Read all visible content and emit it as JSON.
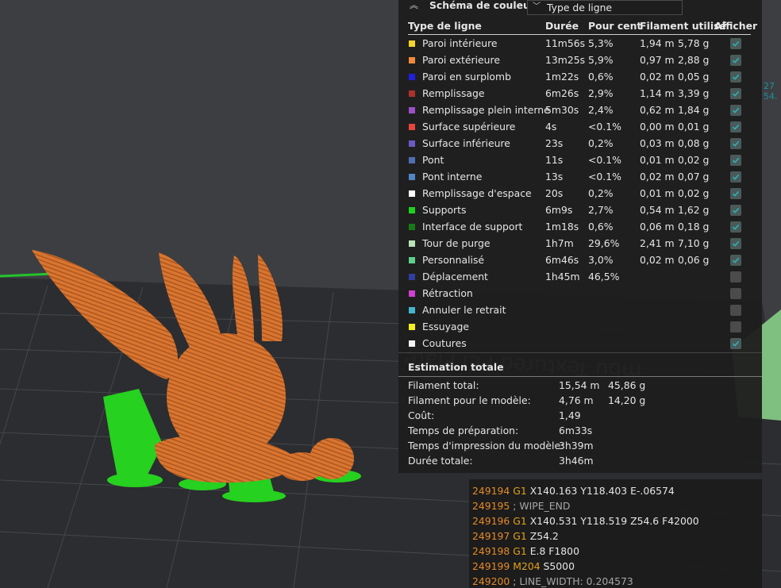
{
  "legend": {
    "title": "Schéma de couleur",
    "view_type": "Type de ligne",
    "columns": [
      "Type de ligne",
      "Durée",
      "Pour cent",
      "Filament utilisé",
      "Afficher"
    ],
    "rows": [
      {
        "name": "Paroi intérieure",
        "color": "#f5d52a",
        "duration": "11m56s",
        "percent": "5,3%",
        "length": "1,94 m",
        "weight": "5,78 g",
        "visible": true
      },
      {
        "name": "Paroi extérieure",
        "color": "#f08a3c",
        "duration": "13m25s",
        "percent": "5,9%",
        "length": "0,97 m",
        "weight": "2,88 g",
        "visible": true
      },
      {
        "name": "Paroi en surplomb",
        "color": "#1f1fe0",
        "duration": "1m22s",
        "percent": "0,6%",
        "length": "0,02 m",
        "weight": "0,05 g",
        "visible": true
      },
      {
        "name": "Remplissage",
        "color": "#b0302c",
        "duration": "6m26s",
        "percent": "2,9%",
        "length": "1,14 m",
        "weight": "3,39 g",
        "visible": true
      },
      {
        "name": "Remplissage plein interne",
        "color": "#9b4fc4",
        "duration": "5m30s",
        "percent": "2,4%",
        "length": "0,62 m",
        "weight": "1,84 g",
        "visible": true
      },
      {
        "name": "Surface supérieure",
        "color": "#e8453c",
        "duration": "4s",
        "percent": "<0.1%",
        "length": "0,00 m",
        "weight": "0,01 g",
        "visible": true
      },
      {
        "name": "Surface inférieure",
        "color": "#6a5bc4",
        "duration": "23s",
        "percent": "0,2%",
        "length": "0,03 m",
        "weight": "0,08 g",
        "visible": true
      },
      {
        "name": "Pont",
        "color": "#4f6fb3",
        "duration": "11s",
        "percent": "<0.1%",
        "length": "0,01 m",
        "weight": "0,02 g",
        "visible": true
      },
      {
        "name": "Pont interne",
        "color": "#4f86c6",
        "duration": "13s",
        "percent": "<0.1%",
        "length": "0,02 m",
        "weight": "0,07 g",
        "visible": true
      },
      {
        "name": "Remplissage d'espace",
        "color": "#ffffff",
        "duration": "20s",
        "percent": "0,2%",
        "length": "0,01 m",
        "weight": "0,02 g",
        "visible": true
      },
      {
        "name": "Supports",
        "color": "#1fd11f",
        "duration": "6m9s",
        "percent": "2,7%",
        "length": "0,54 m",
        "weight": "1,62 g",
        "visible": true
      },
      {
        "name": "Interface de support",
        "color": "#157a15",
        "duration": "1m18s",
        "percent": "0,6%",
        "length": "0,06 m",
        "weight": "0,18 g",
        "visible": true
      },
      {
        "name": "Tour de purge",
        "color": "#b7e3b7",
        "duration": "1h7m",
        "percent": "29,6%",
        "length": "2,41 m",
        "weight": "7,10 g",
        "visible": true
      },
      {
        "name": "Personnalisé",
        "color": "#5ecf8a",
        "duration": "6m46s",
        "percent": "3,0%",
        "length": "0,02 m",
        "weight": "0,06 g",
        "visible": true
      },
      {
        "name": "Déplacement",
        "color": "#2f3fa0",
        "duration": "1h45m",
        "percent": "46,5%",
        "length": "",
        "weight": "",
        "visible": false
      },
      {
        "name": "Rétraction",
        "color": "#d23fd2",
        "duration": "",
        "percent": "",
        "length": "",
        "weight": "",
        "visible": false
      },
      {
        "name": "Annuler le retrait",
        "color": "#45b5cf",
        "duration": "",
        "percent": "",
        "length": "",
        "weight": "",
        "visible": false
      },
      {
        "name": "Essuyage",
        "color": "#f5f01a",
        "duration": "",
        "percent": "",
        "length": "",
        "weight": "",
        "visible": false
      },
      {
        "name": "Coutures",
        "color": "#f2f2f2",
        "duration": "",
        "percent": "",
        "length": "",
        "weight": "",
        "visible": true
      }
    ]
  },
  "summary": {
    "title": "Estimation totale",
    "rows": [
      {
        "label": "Filament total:",
        "v1": "15,54 m",
        "v2": "45,86 g"
      },
      {
        "label": "Filament pour le modèle:",
        "v1": "4,76 m",
        "v2": "14,20 g"
      },
      {
        "label": "Coût:",
        "v1": "1,49",
        "v2": ""
      },
      {
        "label": "Temps de préparation:",
        "v1": "6m33s",
        "v2": ""
      },
      {
        "label": "Temps d'impression du modèle:",
        "v1": "3h39m",
        "v2": ""
      },
      {
        "label": "Durée totale:",
        "v1": "3h46m",
        "v2": ""
      }
    ]
  },
  "gcode": {
    "lines": [
      {
        "num": "249194",
        "cmd": "G1",
        "args": " X140.163 Y118.403 E-.06574",
        "comment": ""
      },
      {
        "num": "249195",
        "cmd": "",
        "args": "",
        "comment": " ; WIPE_END"
      },
      {
        "num": "249196",
        "cmd": "G1",
        "args": " X140.531 Y118.519 Z54.6 F42000",
        "comment": ""
      },
      {
        "num": "249197",
        "cmd": "G1",
        "args": " Z54.2",
        "comment": ""
      },
      {
        "num": "249198",
        "cmd": "G1",
        "args": " E.8 F1800",
        "comment": ""
      },
      {
        "num": "249199",
        "cmd": "M204",
        "args": " S5000",
        "comment": ""
      },
      {
        "num": "249200",
        "cmd": "",
        "args": "",
        "comment": " ; LINE_WIDTH: 0.204573"
      }
    ]
  },
  "viewport": {
    "plate_text": "mbu Textured PEI Plate",
    "edge_label": [
      "27",
      "54."
    ]
  },
  "colors": {
    "panel_bg": "#1e1e1e",
    "checkbox_on": "#4a5a5a",
    "model_orange": "#e07a30",
    "support_green": "#22d51f",
    "gcode_line_number": "#e58a26"
  }
}
